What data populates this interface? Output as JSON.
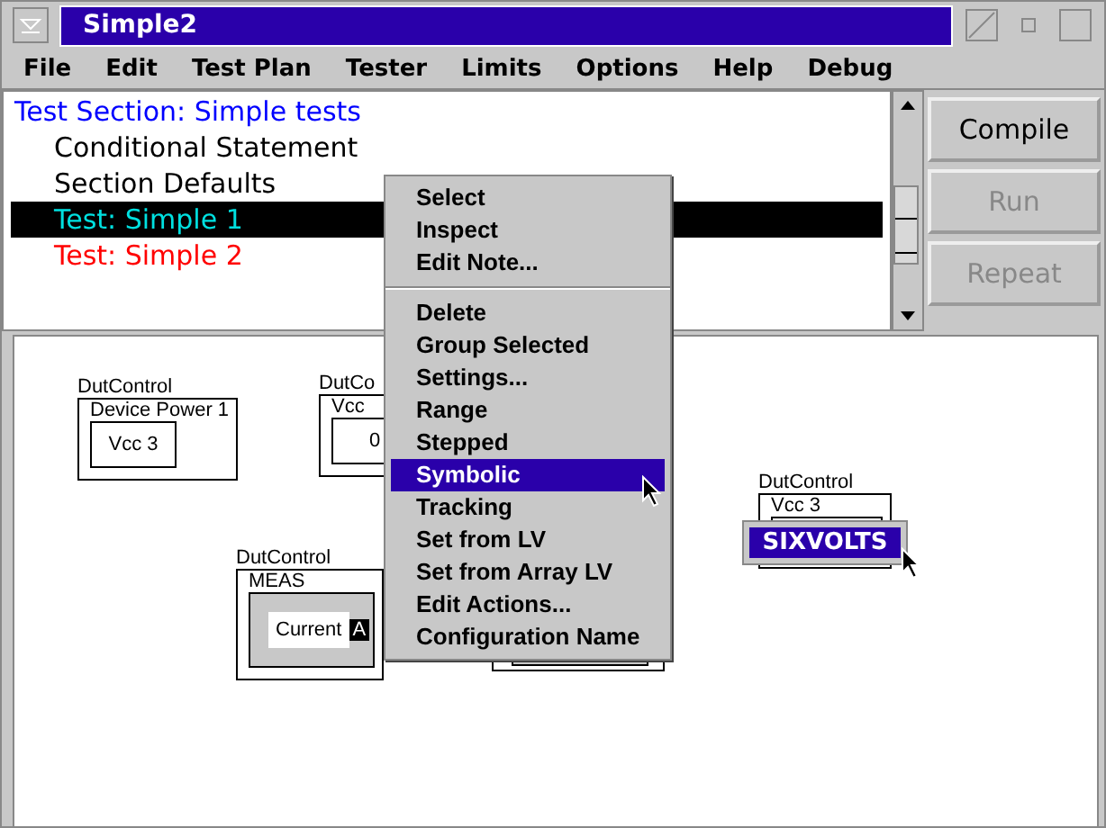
{
  "window": {
    "title": "Simple2"
  },
  "menubar": [
    {
      "label": "File"
    },
    {
      "label": "Edit"
    },
    {
      "label": "Test Plan"
    },
    {
      "label": "Tester"
    },
    {
      "label": "Limits"
    },
    {
      "label": "Options"
    },
    {
      "label": "Help"
    },
    {
      "label": "Debug"
    }
  ],
  "tree": [
    {
      "label": "Test Section: Simple tests",
      "color": "#0000ff",
      "selected": false,
      "children": [
        {
          "label": "Conditional Statement",
          "color": "#000000",
          "selected": false
        },
        {
          "label": "Section Defaults",
          "color": "#000000",
          "selected": false
        },
        {
          "label": "Test: Simple 1",
          "color": "#00e0e0",
          "selected": true
        },
        {
          "label": "Test: Simple 2",
          "color": "#ff0000",
          "selected": false
        }
      ]
    }
  ],
  "buttons": [
    {
      "label": "Compile",
      "disabled": false
    },
    {
      "label": "Run",
      "disabled": true
    },
    {
      "label": "Repeat",
      "disabled": true
    }
  ],
  "canvas_nodes": [
    {
      "kind": "box",
      "type_label": "DutControl",
      "title": "Device Power 1",
      "value": "Vcc 3"
    },
    {
      "kind": "box",
      "type_label": "DutCo",
      "title": "Vcc",
      "value": "0"
    },
    {
      "kind": "meter",
      "type_label": "DutControl",
      "title": "MEAS",
      "value": "Current",
      "unit": "A"
    },
    {
      "kind": "hidden"
    },
    {
      "kind": "popup",
      "type_label": "DutControl",
      "title": "Vcc 3",
      "value": "SIXVOLTS"
    }
  ],
  "context_menu": [
    [
      {
        "label": "Select",
        "selected": false
      },
      {
        "label": "Inspect",
        "selected": false
      },
      {
        "label": "Edit Note...",
        "selected": false
      }
    ],
    [
      {
        "label": "Delete",
        "selected": false
      },
      {
        "label": "Group Selected",
        "selected": false
      },
      {
        "label": "Settings...",
        "selected": false
      },
      {
        "label": "Range",
        "selected": false
      },
      {
        "label": "Stepped",
        "selected": false
      },
      {
        "label": "Symbolic",
        "selected": true
      },
      {
        "label": "Tracking",
        "selected": false
      },
      {
        "label": "Set from LV",
        "selected": false
      },
      {
        "label": "Set from Array LV",
        "selected": false
      },
      {
        "label": "Edit Actions...",
        "selected": false
      },
      {
        "label": "Configuration Name",
        "selected": false
      }
    ]
  ]
}
